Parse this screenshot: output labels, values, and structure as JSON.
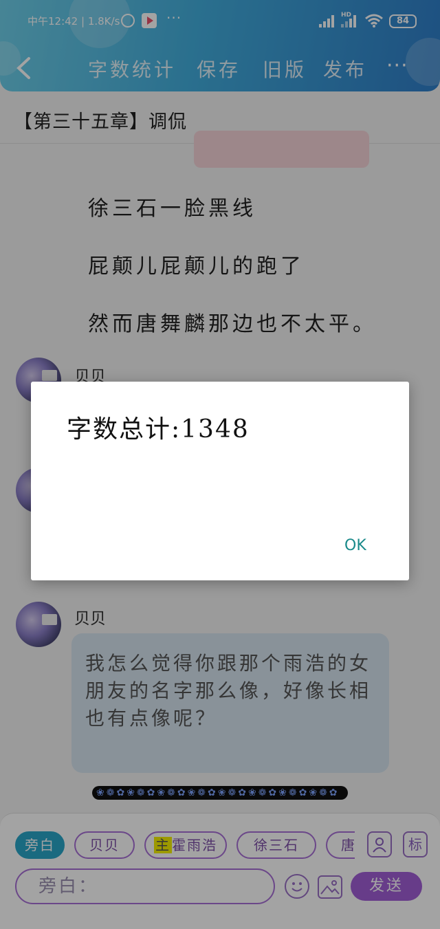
{
  "status_bar": {
    "time": "中午12:42",
    "speed": "1.8K/s",
    "more": "···",
    "network": "HD",
    "battery": "84"
  },
  "nav": {
    "back": "‹",
    "word_count": "字数统计",
    "save": "保存",
    "old_version": "旧版",
    "publish": "发布",
    "more": "···"
  },
  "chapter_title": "【第三十五章】调侃",
  "story": {
    "lines": [
      "徐三石一脸黑线",
      "屁颠儿屁颠儿的跑了",
      "然而唐舞麟那边也不太平。"
    ]
  },
  "chat": {
    "name_1": "贝贝",
    "name_2": "贝贝",
    "message": "我怎么觉得你跟那个雨浩的女朋友的名字那么像，好像长相也有点像呢？"
  },
  "divider": "❀❁✿❀❁✿❀❁✿❀❁✿❀❁✿❀❁✿❀❁✿❀❁✿",
  "composer": {
    "roles": [
      "旁白",
      "贝贝",
      "霍雨浩",
      "徐三石",
      "唐"
    ],
    "highlight_mark": "主",
    "avatar_label": "",
    "tag_label": "标",
    "input_placeholder": "旁白：",
    "send": "发送"
  },
  "dialog": {
    "message": "字数总计:1348",
    "ok": "OK"
  },
  "colors": {
    "header": "#42aede",
    "accent": "#a15fd6",
    "active_chip": "#2aa7c9",
    "ok_text": "#1a8a8a"
  }
}
